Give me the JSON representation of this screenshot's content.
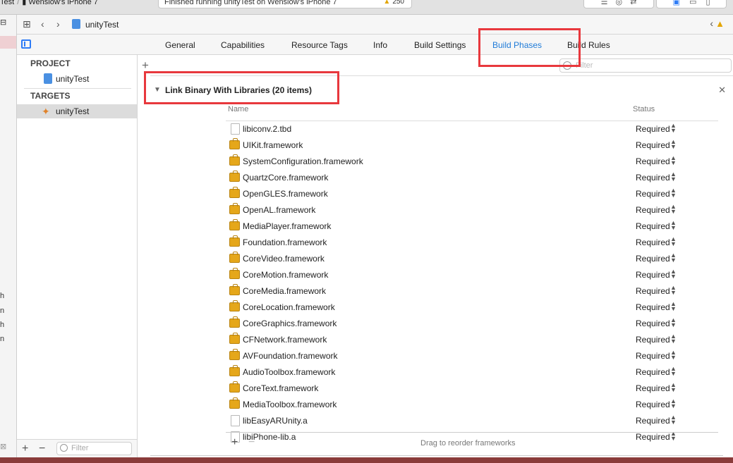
{
  "toolbar": {
    "scheme": "Test",
    "device": "Wenslow's iPhone 7",
    "activity": "Finished running unityTest on Wenslow's iPhone 7",
    "warnings": "250"
  },
  "jumpbar": {
    "title": "unityTest"
  },
  "tabs": {
    "general": "General",
    "capabilities": "Capabilities",
    "resource_tags": "Resource Tags",
    "info": "Info",
    "build_settings": "Build Settings",
    "build_phases": "Build Phases",
    "build_rules": "Build Rules"
  },
  "targets_panel": {
    "project_header": "PROJECT",
    "project_item": "unityTest",
    "targets_header": "TARGETS",
    "target_item": "unityTest",
    "filter_placeholder": "Filter"
  },
  "phase": {
    "filter_placeholder": "Filter",
    "title": "Link Binary With Libraries (20 items)",
    "col_name": "Name",
    "col_status": "Status",
    "drag_hint": "Drag to reorder frameworks",
    "libraries": [
      {
        "name": "libiconv.2.tbd",
        "kind": "file",
        "status": "Required"
      },
      {
        "name": "UIKit.framework",
        "kind": "framework",
        "status": "Required"
      },
      {
        "name": "SystemConfiguration.framework",
        "kind": "framework",
        "status": "Required"
      },
      {
        "name": "QuartzCore.framework",
        "kind": "framework",
        "status": "Required"
      },
      {
        "name": "OpenGLES.framework",
        "kind": "framework",
        "status": "Required"
      },
      {
        "name": "OpenAL.framework",
        "kind": "framework",
        "status": "Required"
      },
      {
        "name": "MediaPlayer.framework",
        "kind": "framework",
        "status": "Required"
      },
      {
        "name": "Foundation.framework",
        "kind": "framework",
        "status": "Required"
      },
      {
        "name": "CoreVideo.framework",
        "kind": "framework",
        "status": "Required"
      },
      {
        "name": "CoreMotion.framework",
        "kind": "framework",
        "status": "Required"
      },
      {
        "name": "CoreMedia.framework",
        "kind": "framework",
        "status": "Required"
      },
      {
        "name": "CoreLocation.framework",
        "kind": "framework",
        "status": "Required"
      },
      {
        "name": "CoreGraphics.framework",
        "kind": "framework",
        "status": "Required"
      },
      {
        "name": "CFNetwork.framework",
        "kind": "framework",
        "status": "Required"
      },
      {
        "name": "AVFoundation.framework",
        "kind": "framework",
        "status": "Required"
      },
      {
        "name": "AudioToolbox.framework",
        "kind": "framework",
        "status": "Required"
      },
      {
        "name": "CoreText.framework",
        "kind": "framework",
        "status": "Required"
      },
      {
        "name": "MediaToolbox.framework",
        "kind": "framework",
        "status": "Required"
      },
      {
        "name": "libEasyARUnity.a",
        "kind": "file",
        "status": "Required"
      },
      {
        "name": "libiPhone-lib.a",
        "kind": "file",
        "status": "Required"
      }
    ]
  }
}
